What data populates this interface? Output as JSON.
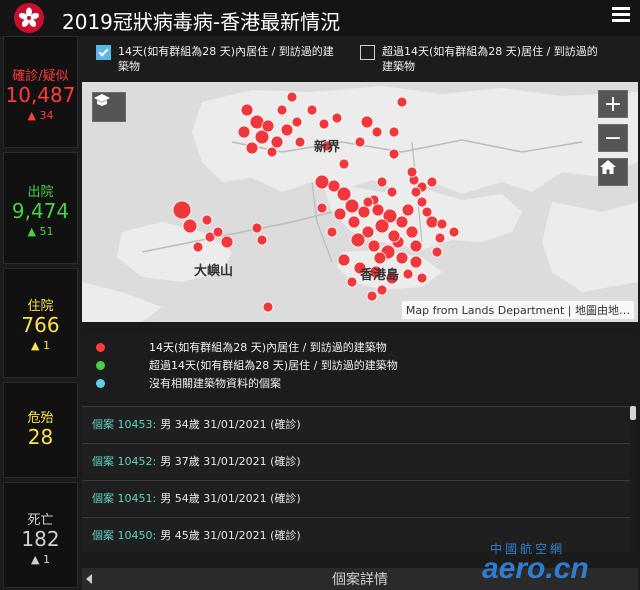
{
  "header": {
    "title": "2019冠狀病毒病-香港最新情況",
    "logo_icon": "bauhinia-logo-icon",
    "menu_icon": "hamburger-menu-icon"
  },
  "stats": [
    {
      "label": "確診/疑似",
      "value": "10,487",
      "delta": "▲ 34",
      "color": "#ff3b3b"
    },
    {
      "label": "出院",
      "value": "9,474",
      "delta": "▲ 51",
      "color": "#47d147"
    },
    {
      "label": "住院",
      "value": "766",
      "delta": "▲ 1",
      "color": "#ffe14d"
    },
    {
      "label": "危殆",
      "value": "28",
      "delta": "",
      "color": "#ffe14d"
    },
    {
      "label": "死亡",
      "value": "182",
      "delta": "▲ 1",
      "color": "#cfcfcf"
    }
  ],
  "filters": [
    {
      "label_line1": "14天(如有群組為28 天)內居住 / 到訪過的建",
      "label_line2": "築物",
      "checked": true
    },
    {
      "label_line1": "超過14天(如有群組為28 天)居住 / 到訪過的",
      "label_line2": "建築物",
      "checked": false
    }
  ],
  "map": {
    "labels": [
      "新界",
      "大嶼山",
      "香港島"
    ],
    "attribution": "Map from Lands Department | 地圖由地…",
    "controls": {
      "zoom_in": "+",
      "zoom_out": "−"
    },
    "icons": {
      "cap": "graduation-cap-icon",
      "home": "home-icon"
    },
    "dot_color": "#f0383c"
  },
  "legend": [
    {
      "color": "#ff3b3b",
      "text": "14天(如有群組為28 天)內居住 / 到訪過的建築物"
    },
    {
      "color": "#47d147",
      "text": "超過14天(如有群組為28 天)居住 / 到訪過的建築物"
    },
    {
      "color": "#5fd0e8",
      "text": "沒有相關建築物資料的個案"
    }
  ],
  "cases": [
    {
      "id": "個案 10453:",
      "detail": "男 34歲 31/01/2021 (確診)"
    },
    {
      "id": "個案 10452:",
      "detail": "男 37歲 31/01/2021 (確診)"
    },
    {
      "id": "個案 10451:",
      "detail": "男 54歲 31/01/2021 (確診)"
    },
    {
      "id": "個案 10450:",
      "detail": "男 45歲 31/01/2021 (確診)"
    }
  ],
  "footer": {
    "label": "個案詳情"
  },
  "watermark": {
    "top": "中國航空網",
    "main": "aero.cn"
  }
}
